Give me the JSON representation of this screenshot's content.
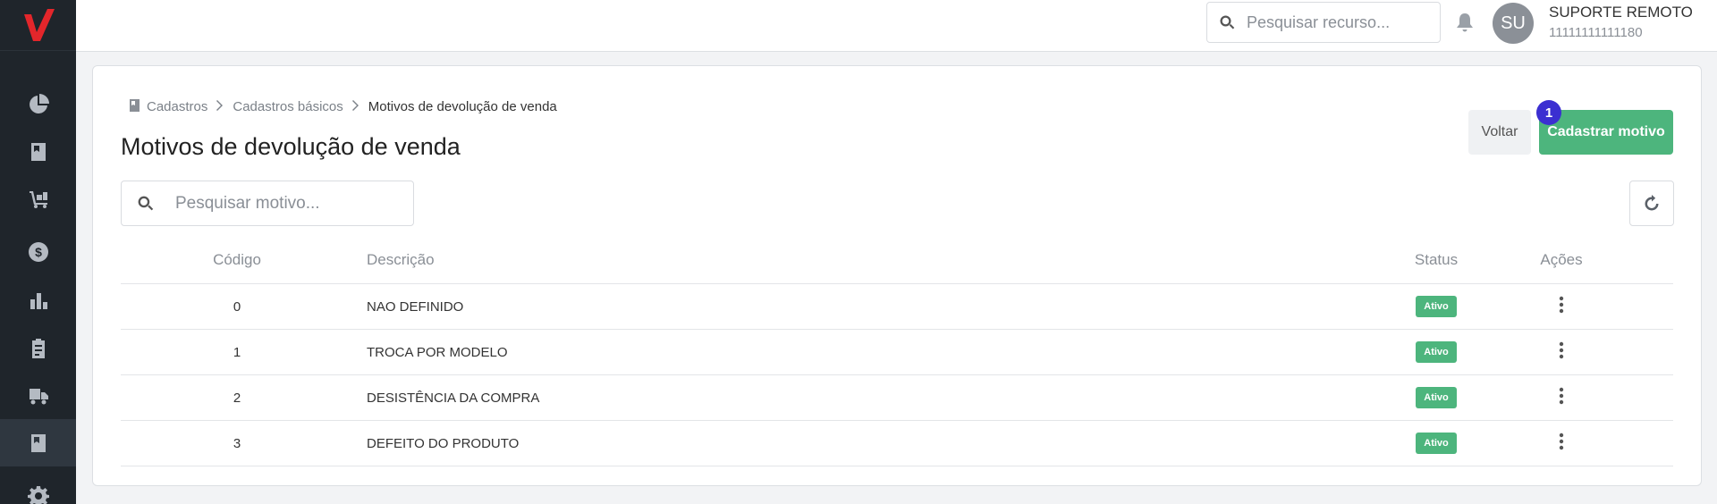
{
  "topbar": {
    "search_placeholder": "Pesquisar recurso...",
    "user": {
      "initials": "SU",
      "name": "SUPORTE REMOTO",
      "id": "11111111111180"
    }
  },
  "sidebar": {
    "items": [
      {
        "icon": "pie-chart-icon"
      },
      {
        "icon": "book-icon"
      },
      {
        "icon": "dolly-icon"
      },
      {
        "icon": "dollar-icon"
      },
      {
        "icon": "bar-chart-icon"
      },
      {
        "icon": "clipboard-icon"
      },
      {
        "icon": "truck-icon"
      },
      {
        "icon": "book-icon",
        "active": true
      },
      {
        "icon": "gear-icon"
      }
    ]
  },
  "breadcrumb": [
    "Cadastros",
    "Cadastros básicos",
    "Motivos de devolução de venda"
  ],
  "page": {
    "title": "Motivos de devolução de venda",
    "back_label": "Voltar",
    "primary_label": "Cadastrar motivo",
    "badge": "1",
    "search_placeholder": "Pesquisar motivo..."
  },
  "table": {
    "headers": {
      "code": "Código",
      "description": "Descrição",
      "status": "Status",
      "actions": "Ações"
    },
    "rows": [
      {
        "code": "0",
        "description": "NAO DEFINIDO",
        "status": "Ativo"
      },
      {
        "code": "1",
        "description": "TROCA POR MODELO",
        "status": "Ativo"
      },
      {
        "code": "2",
        "description": "DESISTÊNCIA DA COMPRA",
        "status": "Ativo"
      },
      {
        "code": "3",
        "description": "DEFEITO DO PRODUTO",
        "status": "Ativo"
      }
    ]
  },
  "colors": {
    "accent": "#4db57d",
    "badge": "#3b2fd1",
    "sidebar": "#1f252b",
    "logo": "#e3262b"
  }
}
